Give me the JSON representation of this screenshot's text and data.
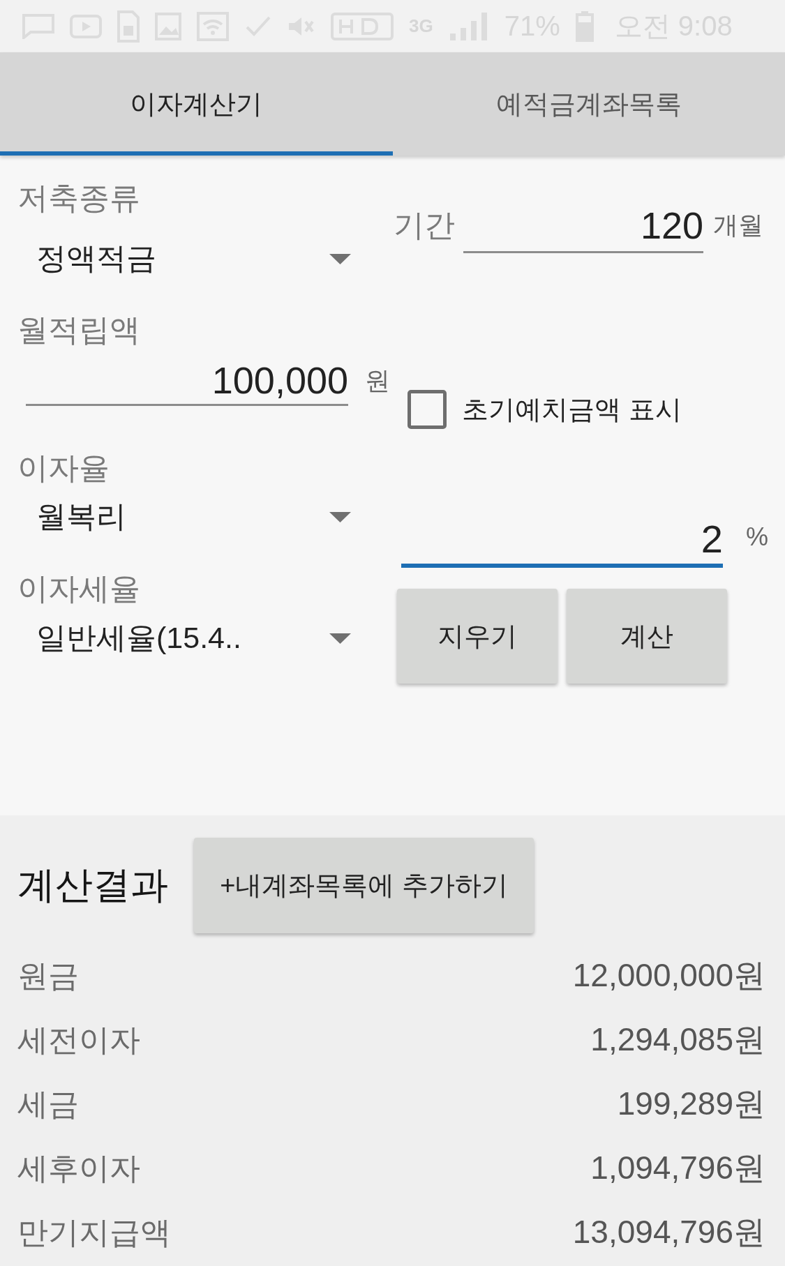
{
  "status_bar": {
    "network_type": "3G",
    "battery_text": "71%",
    "time": "오전 9:08"
  },
  "tabs": [
    {
      "label": "이자계산기",
      "selected": true
    },
    {
      "label": "예적금계좌목록",
      "selected": false
    }
  ],
  "form": {
    "savings_type": {
      "label": "저축종류",
      "value": "정액적금"
    },
    "period": {
      "label": "기간",
      "value": "120",
      "unit": "개월",
      "focused": false
    },
    "monthly_deposit": {
      "label": "월적립액",
      "value": "100,000",
      "unit": "원",
      "focused": false
    },
    "initial_deposit": {
      "label": "초기예치금액 표시",
      "checked": false
    },
    "interest_type": {
      "label": "이자율",
      "value": "월복리"
    },
    "rate": {
      "value": "2",
      "unit": "%",
      "focused": true
    },
    "tax_rate": {
      "label": "이자세율",
      "value": "일반세율(15.4.."
    },
    "buttons": [
      "지우기",
      "계산"
    ]
  },
  "results": {
    "title": "계산결과",
    "add_button": "+내계좌목록에 추가하기",
    "rows": [
      {
        "label": "원금",
        "value": "12,000,000원"
      },
      {
        "label": "세전이자",
        "value": "1,294,085원"
      },
      {
        "label": "세금",
        "value": "199,289원"
      },
      {
        "label": "세후이자",
        "value": "1,094,796원"
      },
      {
        "label": "만기지급액",
        "value": "13,094,796원"
      }
    ]
  }
}
